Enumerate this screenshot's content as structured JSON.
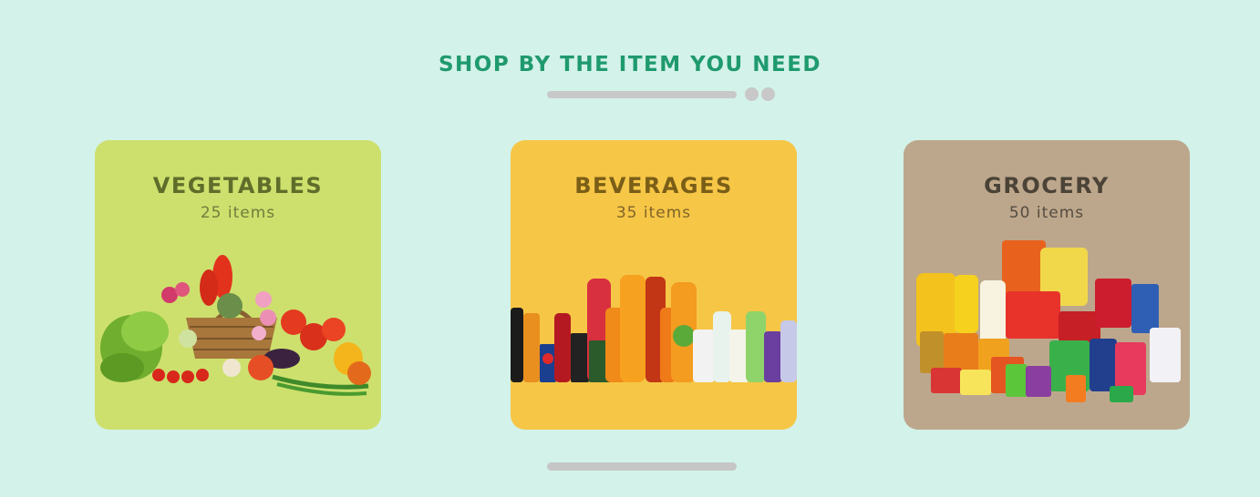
{
  "section": {
    "title": "SHOP BY THE ITEM YOU NEED"
  },
  "categories": [
    {
      "title": "VEGETABLES",
      "count": "25 items",
      "color": "#cde06d",
      "image": "vegetable-basket"
    },
    {
      "title": "BEVERAGES",
      "count": "35 items",
      "color": "#f6c646",
      "image": "beverage-bottles"
    },
    {
      "title": "GROCERY",
      "count": "50 items",
      "color": "#bda78c",
      "image": "grocery-products"
    }
  ],
  "colors": {
    "background": "#d3f2e9",
    "accent": "#1f9a6e",
    "scrollbar": "#c6c6c6"
  }
}
